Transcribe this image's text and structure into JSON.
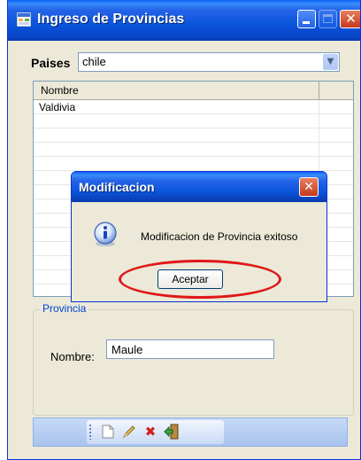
{
  "window": {
    "title": "Ingreso de Provincias"
  },
  "paises": {
    "label": "Paises",
    "value": "chile"
  },
  "grid": {
    "column_header": "Nombre",
    "rows": [
      "Valdivia"
    ]
  },
  "provincia_group": {
    "title": "Provincia",
    "nombre_label": "Nombre:",
    "nombre_value": "Maule"
  },
  "dialog": {
    "title": "Modificacion",
    "message": "Modificacion de Provincia exitoso",
    "ok_label": "Aceptar"
  },
  "toolbar": {
    "icons": [
      "new-document-icon",
      "edit-pencil-icon",
      "delete-x-icon",
      "exit-door-icon"
    ]
  },
  "colors": {
    "title_blue": "#0a55dc",
    "close_red": "#c4391c",
    "highlight_red": "#e01818",
    "group_title_blue": "#0046d5"
  }
}
